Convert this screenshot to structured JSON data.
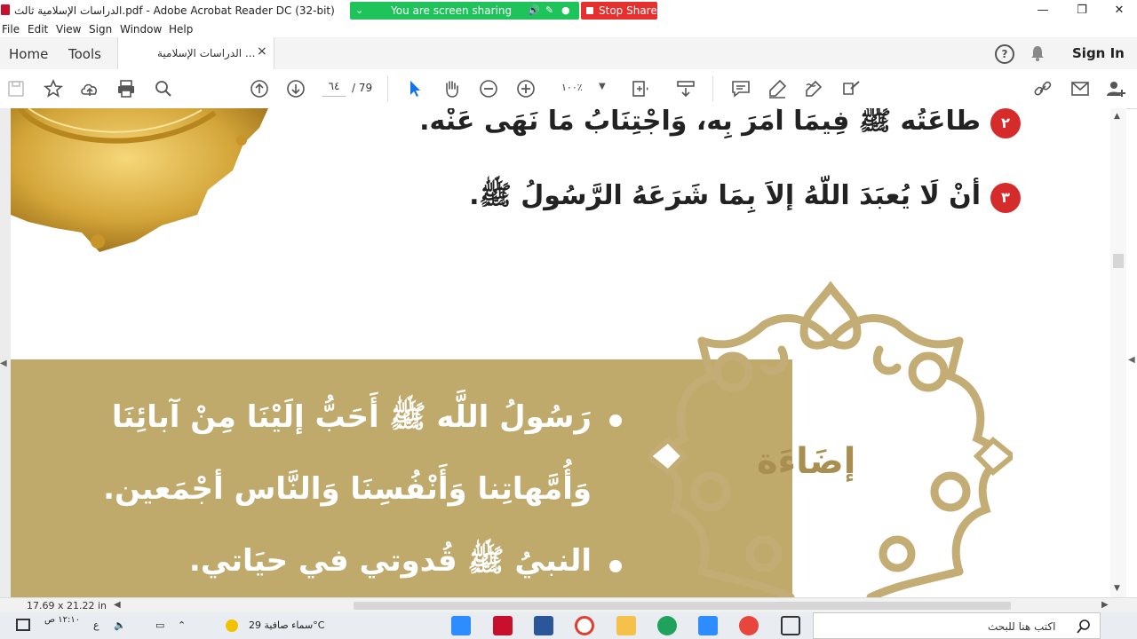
{
  "window": {
    "title": "الدراسات الإسلامية ثالث.pdf - Adobe Acrobat Reader DC (32-bit)",
    "controls": [
      "—",
      "❐",
      "✕"
    ]
  },
  "screen_share": {
    "message": "You are screen sharing",
    "stop_label": "Stop Share"
  },
  "menu": [
    "File",
    "Edit",
    "View",
    "Sign",
    "Window",
    "Help"
  ],
  "tabs": {
    "home": "Home",
    "tools": "Tools",
    "document": "الدراسات الإسلامية ...",
    "close": "×"
  },
  "header_right": {
    "help": "?",
    "sign_in": "Sign In"
  },
  "toolbar": {
    "page_current": "٦٤",
    "page_total": "/ 79",
    "zoom": "١٠٠٪"
  },
  "document": {
    "line2_num": "٢",
    "line2_text": "طَاعَتُه ﷺ فِيمَا أَمَرَ بِه، وَاجْتِنَابُ مَا نَهَى عَنْه.",
    "line3_num": "٣",
    "line3_text": "أنْ لَا يُعبَدَ اللّهُ إلاَ بِمَا شَرَعَهُ الرَّسُولُ ﷺ.",
    "band_line1": "رَسُولُ اللَّه ﷺ أَحَبُّ إلَيْنَا مِنْ آبائِنَا",
    "band_line2": "وَأُمَّهاتِنا وَأَنْفُسِنَا وَالنَّاس أجْمَعين.",
    "band_line3": "النبيُ ﷺ قُدوتي في حيَاتي.",
    "frame_title": "إضَاءَة"
  },
  "status": {
    "page_size": "17.69 x 21.22 in"
  },
  "taskbar": {
    "search_placeholder": "اكتب هنا للبحث",
    "weather": "سماء صافية  29°C",
    "time": "١٢:١٠ ص",
    "lang": "ع"
  },
  "colors": {
    "gold_band": "#bfa96b",
    "share_green": "#1ec35a",
    "stop_red": "#e5302e",
    "badge_red": "#d62b2b"
  }
}
